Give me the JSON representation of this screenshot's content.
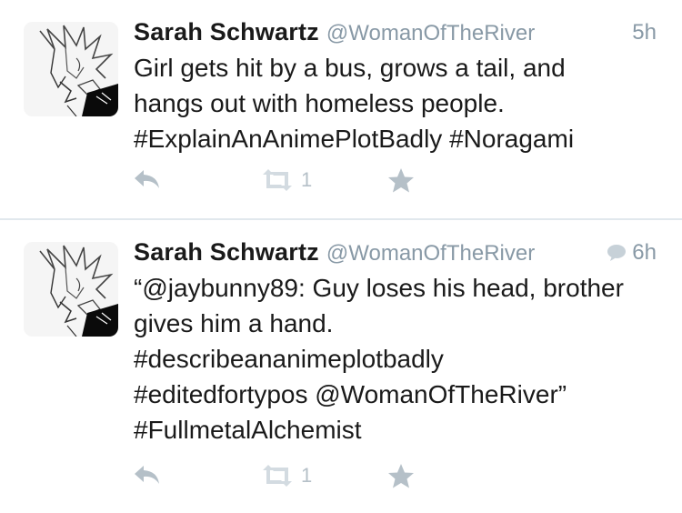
{
  "tweets": [
    {
      "name": "Sarah Schwartz",
      "handle": "@WomanOfTheRiver",
      "time": "5h",
      "has_conversation_icon": false,
      "lines": [
        "Girl gets hit by a bus, grows a tail, and",
        "hangs out with homeless people.",
        "#ExplainAnAnimePlotBadly #Noragami"
      ],
      "retweet_count": "1"
    },
    {
      "name": "Sarah Schwartz",
      "handle": "@WomanOfTheRiver",
      "time": "6h",
      "has_conversation_icon": true,
      "lines": [
        "“@jaybunny89: Guy loses his head, brother",
        "gives him a hand.",
        "#describeananimeplotbadly",
        "#editedfortypos @WomanOfTheRiver”",
        "#FullmetalAlchemist"
      ],
      "retweet_count": "1"
    }
  ],
  "icons": {
    "reply": "reply-icon",
    "retweet": "retweet-icon",
    "favorite": "star-icon",
    "conversation": "speech-bubble-icon"
  },
  "colors": {
    "text": "#1a1a1a",
    "muted": "#8899a6",
    "action": "#b5c0c8",
    "divider": "#e1e8ed"
  }
}
